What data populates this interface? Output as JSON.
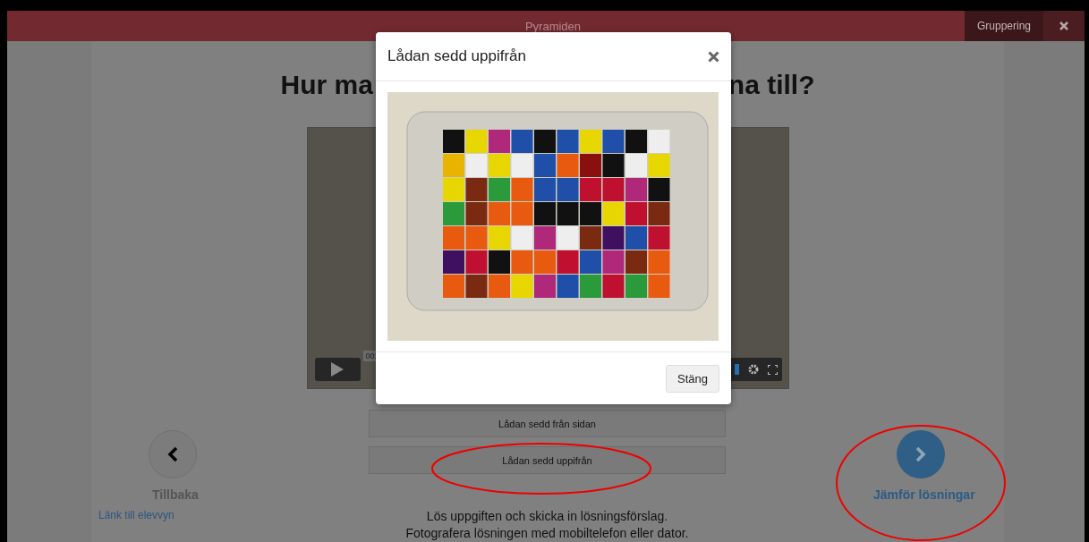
{
  "top_bar": {
    "title": "Pyramiden",
    "group_button": "Gruppering"
  },
  "heading_visible_parts": [
    "Hur ma",
    "na till?"
  ],
  "video_player": {
    "time_tooltip": "00:"
  },
  "view_buttons": [
    {
      "label": "Lådan sedd från sidan"
    },
    {
      "label": "Lådan sedd uppifrån"
    }
  ],
  "instructions": [
    "Lös uppgiften och skicka in lösningsförslag.",
    "Fotografera lösningen med mobiltelefon eller dator."
  ],
  "back": {
    "label": "Tillbaka"
  },
  "student_view_link": "Länk till elevvyn",
  "next": {
    "label": "Jämför lösningar"
  },
  "modal": {
    "title": "Lådan sedd uppifrån",
    "close_button": "Stäng"
  }
}
